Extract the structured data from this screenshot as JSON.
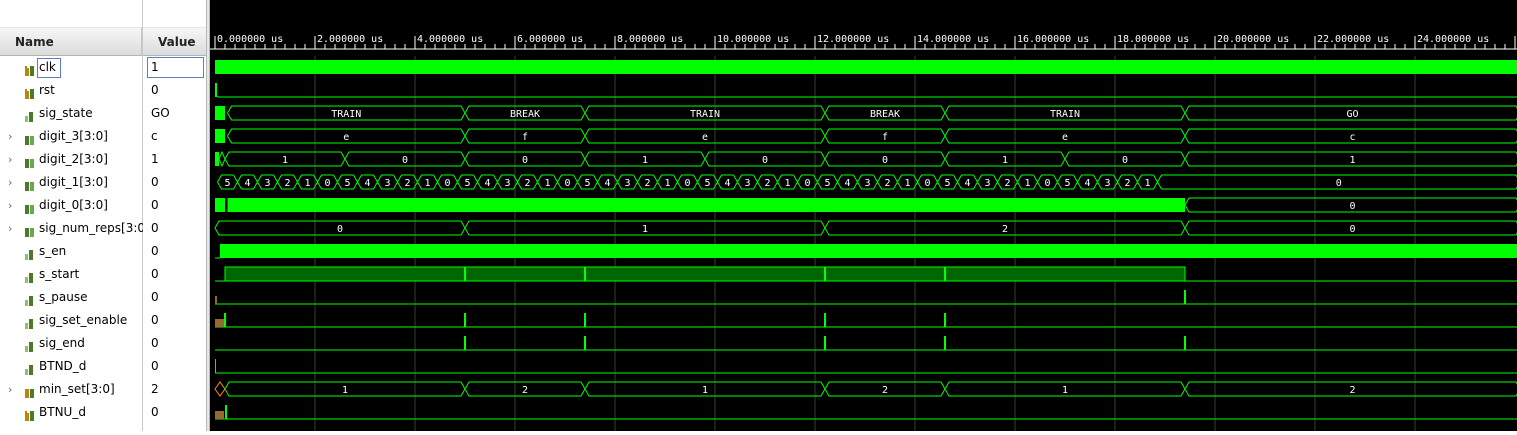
{
  "columns": {
    "name": "Name",
    "value": "Value"
  },
  "colors": {
    "wave": "#00ff00",
    "background": "#000000",
    "bus_fill": "#006600",
    "marker": "#996633"
  },
  "time_ticks": [
    "0.000000 us",
    "2.000000 us",
    "4.000000 us",
    "6.000000 us",
    "8.000000 us",
    "10.000000 us",
    "12.000000 us",
    "14.000000 us",
    "16.000000 us",
    "18.000000 us",
    "20.000000 us",
    "22.000000 us",
    "24.000000 us"
  ],
  "signals": [
    {
      "name": "clk",
      "value": "1",
      "icon": "bit-input-icon",
      "expandable": false,
      "selected": true
    },
    {
      "name": "rst",
      "value": "0",
      "icon": "bit-input-icon",
      "expandable": false
    },
    {
      "name": "sig_state",
      "value": "GO",
      "icon": "bit-signal-icon",
      "expandable": false
    },
    {
      "name": "digit_3[3:0]",
      "value": "c",
      "icon": "bus-icon",
      "expandable": true
    },
    {
      "name": "digit_2[3:0]",
      "value": "1",
      "icon": "bus-icon",
      "expandable": true
    },
    {
      "name": "digit_1[3:0]",
      "value": "0",
      "icon": "bus-icon",
      "expandable": true
    },
    {
      "name": "digit_0[3:0]",
      "value": "0",
      "icon": "bus-icon",
      "expandable": true
    },
    {
      "name": "sig_num_reps[3:0]",
      "value": "0",
      "icon": "bus-icon",
      "expandable": true
    },
    {
      "name": "s_en",
      "value": "0",
      "icon": "bit-signal-icon",
      "expandable": false
    },
    {
      "name": "s_start",
      "value": "0",
      "icon": "bit-signal-icon",
      "expandable": false
    },
    {
      "name": "s_pause",
      "value": "0",
      "icon": "bit-signal-icon",
      "expandable": false
    },
    {
      "name": "sig_set_enable",
      "value": "0",
      "icon": "bit-signal-icon",
      "expandable": false
    },
    {
      "name": "sig_end",
      "value": "0",
      "icon": "bit-signal-icon",
      "expandable": false
    },
    {
      "name": "BTND_d",
      "value": "0",
      "icon": "bit-signal-icon",
      "expandable": false
    },
    {
      "name": "min_set[3:0]",
      "value": "2",
      "icon": "bus-input-icon",
      "expandable": true
    },
    {
      "name": "BTNU_d",
      "value": "0",
      "icon": "bit-input-icon",
      "expandable": false
    }
  ],
  "waves": {
    "sig_state": [
      {
        "start_us": 0.0,
        "end_us": 5.0,
        "label": "TRAIN"
      },
      {
        "start_us": 5.0,
        "end_us": 7.4,
        "label": "BREAK"
      },
      {
        "start_us": 7.4,
        "end_us": 12.2,
        "label": "TRAIN"
      },
      {
        "start_us": 12.2,
        "end_us": 14.6,
        "label": "BREAK"
      },
      {
        "start_us": 14.6,
        "end_us": 19.4,
        "label": "TRAIN"
      },
      {
        "start_us": 19.4,
        "end_us": 26.1,
        "label": "GO"
      }
    ],
    "digit_3": [
      {
        "start_us": 0.0,
        "end_us": 5.0,
        "label": "e"
      },
      {
        "start_us": 5.0,
        "end_us": 7.4,
        "label": "f"
      },
      {
        "start_us": 7.4,
        "end_us": 12.2,
        "label": "e"
      },
      {
        "start_us": 12.2,
        "end_us": 14.6,
        "label": "f"
      },
      {
        "start_us": 14.6,
        "end_us": 19.4,
        "label": "e"
      },
      {
        "start_us": 19.4,
        "end_us": 26.1,
        "label": "c"
      }
    ],
    "digit_2": [
      {
        "start_us": 0.2,
        "end_us": 2.6,
        "label": "1"
      },
      {
        "start_us": 2.6,
        "end_us": 5.0,
        "label": "0"
      },
      {
        "start_us": 5.0,
        "end_us": 7.4,
        "label": "0"
      },
      {
        "start_us": 7.4,
        "end_us": 9.8,
        "label": "1"
      },
      {
        "start_us": 9.8,
        "end_us": 12.2,
        "label": "0"
      },
      {
        "start_us": 12.2,
        "end_us": 14.6,
        "label": "0"
      },
      {
        "start_us": 14.6,
        "end_us": 17.0,
        "label": "1"
      },
      {
        "start_us": 17.0,
        "end_us": 19.4,
        "label": "0"
      },
      {
        "start_us": 19.4,
        "end_us": 26.1,
        "label": "1"
      }
    ],
    "digit_1_cycle": [
      "5",
      "4",
      "3",
      "2",
      "1",
      "0"
    ],
    "digit_1_end_us": 19.0,
    "digit_1_after": "0",
    "digit_0_after": "0",
    "digit_0_busy_end_us": 19.4,
    "sig_num_reps": [
      {
        "start_us": 0.0,
        "end_us": 5.0,
        "label": "0"
      },
      {
        "start_us": 5.0,
        "end_us": 12.2,
        "label": "1"
      },
      {
        "start_us": 12.2,
        "end_us": 19.4,
        "label": "2"
      },
      {
        "start_us": 19.4,
        "end_us": 26.1,
        "label": "0"
      }
    ],
    "min_set": [
      {
        "start_us": 0.2,
        "end_us": 5.0,
        "label": "1"
      },
      {
        "start_us": 5.0,
        "end_us": 7.4,
        "label": "2"
      },
      {
        "start_us": 7.4,
        "end_us": 12.2,
        "label": "1"
      },
      {
        "start_us": 12.2,
        "end_us": 14.6,
        "label": "2"
      },
      {
        "start_us": 14.6,
        "end_us": 19.4,
        "label": "1"
      },
      {
        "start_us": 19.4,
        "end_us": 26.1,
        "label": "2"
      }
    ],
    "pulse_times_us": [
      0.2,
      5.0,
      7.4,
      12.2,
      14.6
    ],
    "end_times_us": [
      5.0,
      7.4,
      12.2,
      14.6,
      19.4
    ],
    "s_start_high": {
      "start_us": 0.2,
      "end_us": 19.4
    },
    "s_pause_rise_us": 19.4
  }
}
